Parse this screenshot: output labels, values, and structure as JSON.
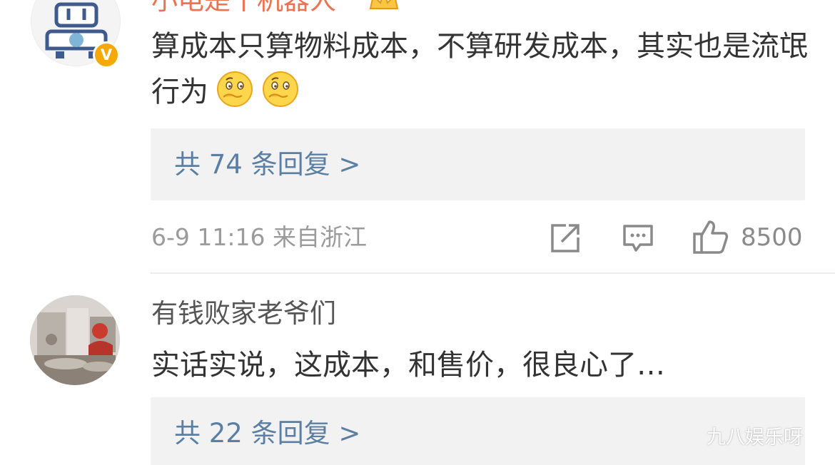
{
  "comments": [
    {
      "username": "小电是个机器人",
      "verified_badge": "V",
      "text": "算成本只算物料成本，不算研发成本，其实也是流氓行为",
      "emojis": [
        "thinking-emoji",
        "thinking-emoji"
      ],
      "reply_link": "共 74 条回复 >",
      "meta": "6-9 11:16 来自浙江",
      "like_count": "8500"
    },
    {
      "username": "有钱败家老爷们",
      "text": "实话实说，这成本，和售价，很良心了…",
      "reply_link": "共 22 条回复 >"
    }
  ],
  "watermark": "九八娱乐呀",
  "icons": {
    "share": "share-icon",
    "comment": "comment-icon",
    "like": "thumbs-up-icon"
  },
  "colors": {
    "username_highlight": "#eb7350",
    "link": "#5b7fa3",
    "badge": "#f6a70a",
    "reply_bg": "#f2f2f2"
  }
}
